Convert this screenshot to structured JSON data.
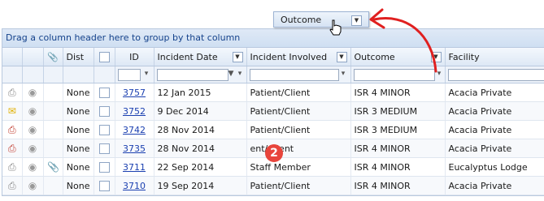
{
  "group_bar_text": "Drag a column header here to group by that column",
  "dragged_column": {
    "label": "Outcome"
  },
  "badge": {
    "number": "2"
  },
  "columns": [
    {
      "key": "icon1",
      "label": ""
    },
    {
      "key": "icon2",
      "label": ""
    },
    {
      "key": "attach",
      "label": "",
      "icon": "paperclip-icon"
    },
    {
      "key": "dist",
      "label": "Dist"
    },
    {
      "key": "check",
      "label": ""
    },
    {
      "key": "id",
      "label": "ID"
    },
    {
      "key": "date",
      "label": "Incident Date"
    },
    {
      "key": "involved",
      "label": "Incident Involved"
    },
    {
      "key": "outcome",
      "label": "Outcome"
    },
    {
      "key": "facility",
      "label": "Facility"
    }
  ],
  "rows": [
    {
      "icon": "printer-icon",
      "icon_color": "#888888",
      "eye": "eye-icon",
      "attach": false,
      "dist": "None",
      "id": "3757",
      "date": "12 Jan 2015",
      "involved": "Patient/Client",
      "outcome": "ISR 4 MINOR",
      "facility": "Acacia Private"
    },
    {
      "icon": "envelope-icon",
      "icon_color": "#e0b000",
      "eye": "eye-icon",
      "attach": false,
      "dist": "None",
      "id": "3752",
      "date": "9 Dec 2014",
      "involved": "Patient/Client",
      "outcome": "ISR 3 MEDIUM",
      "facility": "Acacia Private"
    },
    {
      "icon": "printer-red-icon",
      "icon_color": "#c0392b",
      "eye": "eye-icon",
      "attach": false,
      "dist": "None",
      "id": "3742",
      "date": "28 Nov 2014",
      "involved": "Patient/Client",
      "outcome": "ISR 3 MEDIUM",
      "facility": "Acacia Private"
    },
    {
      "icon": "printer-red-icon",
      "icon_color": "#c0392b",
      "eye": "eye-icon",
      "attach": false,
      "dist": "None",
      "id": "3735",
      "date": "28 Nov 2014",
      "involved": "ent/Client",
      "outcome": "ISR 4 MINOR",
      "facility": "Acacia Private"
    },
    {
      "icon": "printer-icon",
      "icon_color": "#888888",
      "eye": "eye-icon",
      "attach": true,
      "dist": "None",
      "id": "3711",
      "date": "22 Sep 2014",
      "involved": "Staff Member",
      "outcome": "ISR 4 MINOR",
      "facility": "Eucalyptus Lodge"
    },
    {
      "icon": "printer-icon",
      "icon_color": "#888888",
      "eye": "eye-icon",
      "attach": false,
      "dist": "None",
      "id": "3710",
      "date": "19 Sep 2014",
      "involved": "Patient/Client",
      "outcome": "ISR 4 MINOR",
      "facility": "Acacia Private"
    }
  ]
}
